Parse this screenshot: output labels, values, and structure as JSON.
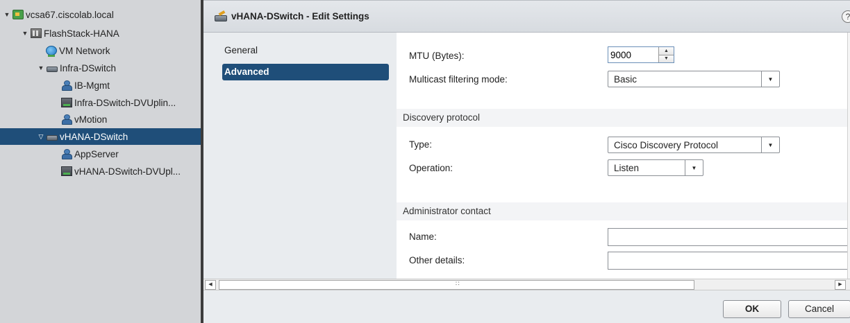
{
  "inventory_tree": {
    "items": [
      {
        "label": "vcsa67.ciscolab.local",
        "icon": "vcenter-icon",
        "expander": "expanded"
      },
      {
        "label": "FlashStack-HANA",
        "icon": "datacenter-icon",
        "expander": "expanded"
      },
      {
        "label": "VM Network",
        "icon": "network-icon",
        "expander": "none"
      },
      {
        "label": "Infra-DSwitch",
        "icon": "distributed-switch-icon",
        "expander": "expanded"
      },
      {
        "label": "IB-Mgmt",
        "icon": "port-group-icon",
        "expander": "none"
      },
      {
        "label": "Infra-DSwitch-DVUplin...",
        "icon": "uplink-port-group-icon",
        "expander": "none"
      },
      {
        "label": "vMotion",
        "icon": "port-group-icon",
        "expander": "none"
      },
      {
        "label": "vHANA-DSwitch",
        "icon": "distributed-switch-icon",
        "expander": "expanded",
        "selected": true
      },
      {
        "label": "AppServer",
        "icon": "port-group-icon",
        "expander": "none"
      },
      {
        "label": "vHANA-DSwitch-DVUpl...",
        "icon": "uplink-port-group-icon",
        "expander": "none"
      }
    ]
  },
  "dialog": {
    "title": "vHANA-DSwitch - Edit Settings",
    "help_label": "?",
    "nav": [
      {
        "label": "General",
        "active": false
      },
      {
        "label": "Advanced",
        "active": true
      }
    ],
    "advanced": {
      "mtu_label": "MTU (Bytes):",
      "mtu_value": "9000",
      "multicast_label": "Multicast filtering mode:",
      "multicast_value": "Basic",
      "discovery_section": "Discovery protocol",
      "type_label": "Type:",
      "type_value": "Cisco Discovery Protocol",
      "operation_label": "Operation:",
      "operation_value": "Listen",
      "admin_section": "Administrator contact",
      "name_label": "Name:",
      "name_value": "",
      "other_label": "Other details:",
      "other_value": ""
    },
    "buttons": {
      "ok": "OK",
      "cancel": "Cancel"
    }
  },
  "colors": {
    "selection": "#1f4e79",
    "tree_bg": "#d3d5d8",
    "dialog_bg": "#e9ecef",
    "section_bg": "#f3f4f6"
  }
}
